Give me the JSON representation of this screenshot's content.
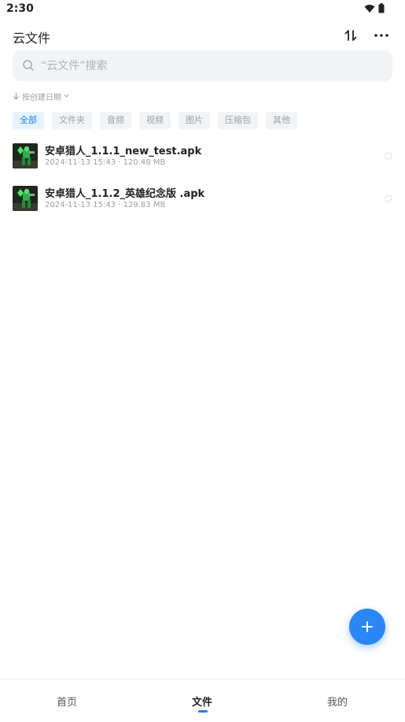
{
  "status_bar": {
    "time": "2:30"
  },
  "app_bar": {
    "title": "云文件"
  },
  "search": {
    "placeholder": "“云文件”搜索",
    "value": ""
  },
  "sort": {
    "label": "按创建日期"
  },
  "filters": [
    {
      "label": "全部",
      "active": true
    },
    {
      "label": "文件夹",
      "active": false
    },
    {
      "label": "音频",
      "active": false
    },
    {
      "label": "视频",
      "active": false
    },
    {
      "label": "图片",
      "active": false
    },
    {
      "label": "压缩包",
      "active": false
    },
    {
      "label": "其他",
      "active": false
    }
  ],
  "files": [
    {
      "name": "安卓猎人_1.1.1_new_test.apk",
      "meta": "2024-11-13 15:43 · 120.48 MB",
      "icon": "apk-icon"
    },
    {
      "name": "安卓猎人_1.1.2_英雄纪念版 .apk",
      "meta": "2024-11-13 15:43 · 129.83 MB",
      "icon": "apk-icon"
    }
  ],
  "fab": {
    "icon": "plus-icon"
  },
  "bottom_nav": [
    {
      "label": "首页",
      "active": false
    },
    {
      "label": "文件",
      "active": true
    },
    {
      "label": "我的",
      "active": false
    }
  ],
  "colors": {
    "accent": "#1f7ff0",
    "fab": "#2a87f5"
  }
}
